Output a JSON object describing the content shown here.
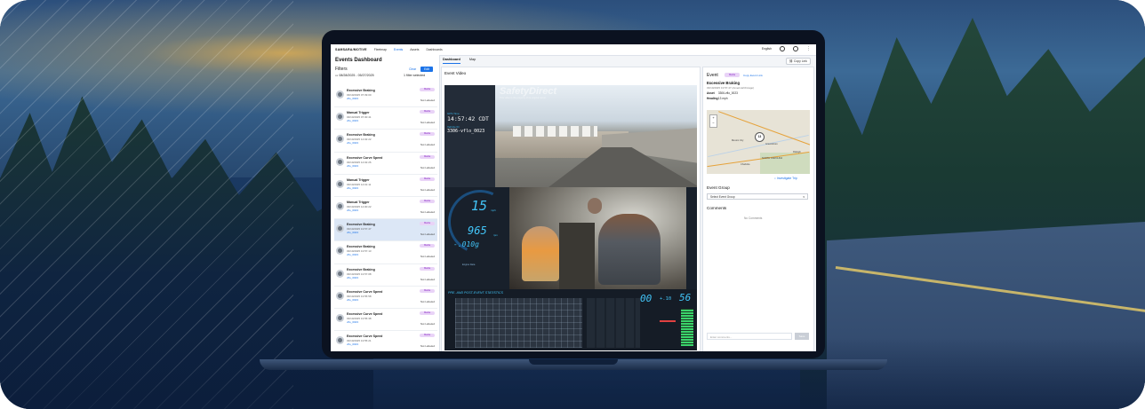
{
  "app": {
    "logo": "SAMSARA/MOTIVE",
    "nav": [
      "Fleetmap",
      "Events",
      "Assets",
      "Dashboards"
    ],
    "language": "English"
  },
  "sidebar": {
    "title": "Events Dashboard",
    "filters_label": "Filters",
    "clear_label": "Clear",
    "edit_label": "Edit",
    "date_range": "08/28/2025 - 05/27/2025",
    "filter_count": "1 filter selected",
    "events": [
      {
        "name": "Excessive Braking",
        "date": "03/10/2025 07:39:00",
        "vehicle": "vflo_0023",
        "badge": "Media",
        "label": "Not Labeled"
      },
      {
        "name": "Manual Trigger",
        "date": "03/10/2025 07:30:41",
        "vehicle": "vflo_0023",
        "badge": "Media",
        "label": "Not Labeled"
      },
      {
        "name": "Excessive Braking",
        "date": "03/10/2025 14:02:22",
        "vehicle": "vflo_0023",
        "badge": "Media",
        "label": "Not Labeled"
      },
      {
        "name": "Excessive Curve Speed",
        "date": "03/10/2025 14:02:26",
        "vehicle": "vflo_0023",
        "badge": "Media",
        "label": "Not Labeled"
      },
      {
        "name": "Manual Trigger",
        "date": "03/10/2025 14:01:11",
        "vehicle": "vflo_0023",
        "badge": "Media",
        "label": "Not Labeled"
      },
      {
        "name": "Manual Trigger",
        "date": "03/10/2025 14:00:22",
        "vehicle": "vflo_0023",
        "badge": "Media",
        "label": "Not Labeled"
      },
      {
        "name": "Excessive Braking",
        "date": "03/10/2025 13:57:47",
        "vehicle": "vflo_0023",
        "badge": "Media",
        "label": "Not Labeled"
      },
      {
        "name": "Excessive Braking",
        "date": "03/10/2025 13:57:13",
        "vehicle": "vflo_0023",
        "badge": "Media",
        "label": "Not Labeled"
      },
      {
        "name": "Excessive Braking",
        "date": "03/10/2025 13:57:08",
        "vehicle": "vflo_0023",
        "badge": "Media",
        "label": "Not Labeled"
      },
      {
        "name": "Excessive Curve Speed",
        "date": "03/10/2025 13:55:58",
        "vehicle": "vflo_0023",
        "badge": "Media",
        "label": "Not Labeled"
      },
      {
        "name": "Excessive Curve Speed",
        "date": "03/10/2025 13:55:38",
        "vehicle": "vflo_0023",
        "badge": "Media",
        "label": "Not Labeled"
      },
      {
        "name": "Excessive Curve Speed",
        "date": "03/10/2025 13:55:21",
        "vehicle": "vflo_0023",
        "badge": "Media",
        "label": "Not Labeled"
      }
    ],
    "selected_index": 6
  },
  "main": {
    "tabs": [
      "Dashboard",
      "Map"
    ],
    "copy_link": "Copy Link",
    "section_title": "Event Video",
    "overlay": {
      "time_label": "GPS Time",
      "time_value": "14:57:42 CDT",
      "vehicle_label": "Vehicle ID",
      "vehicle_value": "3306-vflo_0023",
      "watermark": "SafetyDirect",
      "watermark_sub": "This video is the property of its original owner.",
      "speed": "15",
      "speed_unit": "mph",
      "rpm": "965",
      "rpm_unit": "rpm",
      "accel": "-.010g",
      "gauge_caption": "Engine Data",
      "stats_title": "PRE- AND POST-EVENT STATISTICS",
      "stat_a": "00",
      "stat_b": "+.10",
      "stat_c": "56"
    }
  },
  "details": {
    "title": "Event",
    "badge": "Media",
    "copy_link": "Copy Event Link",
    "event_name": "Excessive Braking",
    "event_date": "03/10/2025 13:57:47 (America/Chicago)",
    "asset_label": "Asset",
    "asset_value": "3306-vflo_0023",
    "heading_label": "Heading",
    "heading_value": "13 mph",
    "map": {
      "pin_label": "13",
      "places": [
        "Mexico City",
        "Greensboro",
        "Raleigh",
        "Charlotte",
        "NORTH CAROLINA"
      ]
    },
    "investigate": "Investigate Trip",
    "event_group_label": "Event Group",
    "event_group_placeholder": "Select Event Group",
    "comments_label": "Comments",
    "no_comments": "No Comments",
    "comment_placeholder": "Enter comments...",
    "send_label": "Save"
  }
}
